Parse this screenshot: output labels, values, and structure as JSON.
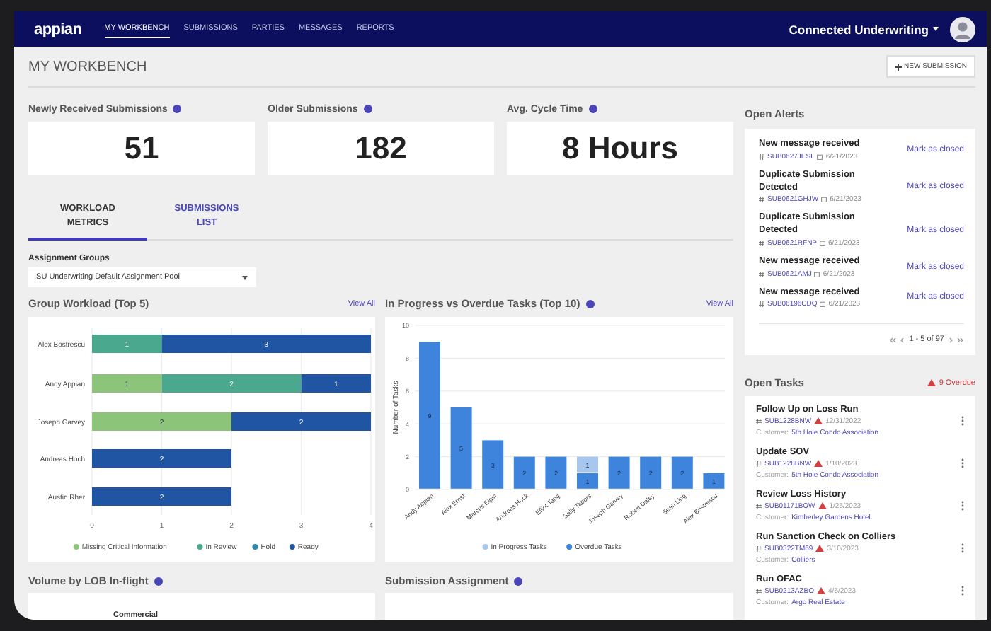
{
  "nav": {
    "logo": "appian",
    "items": [
      {
        "label": "MY WORKBENCH",
        "selected": true
      },
      {
        "label": "SUBMISSIONS",
        "selected": false
      },
      {
        "label": "PARTIES",
        "selected": false
      },
      {
        "label": "MESSAGES",
        "selected": false
      },
      {
        "label": "REPORTS",
        "selected": false
      }
    ],
    "app_menu": "Connected Underwriting"
  },
  "page": {
    "title": "MY WORKBENCH",
    "new_button": "NEW SUBMISSION"
  },
  "kpis": [
    {
      "label": "Newly Received Submissions",
      "value": "51"
    },
    {
      "label": "Older Submissions",
      "value": "182"
    },
    {
      "label": "Avg. Cycle Time",
      "value": "8 Hours"
    }
  ],
  "tabs": [
    {
      "label": "WORKLOAD METRICS",
      "selected": true
    },
    {
      "label": "SUBMISSIONS LIST",
      "selected": false
    }
  ],
  "assignment_groups": {
    "label": "Assignment Groups",
    "value": "ISU Underwriting Default Assignment Pool"
  },
  "group_workload": {
    "title": "Group Workload (Top 5)",
    "link": "View All",
    "chart_data": {
      "type": "bar",
      "orientation": "horizontal",
      "stacked": true,
      "categories": [
        "Alex Bostrescu",
        "Andy Appian",
        "Joseph Garvey",
        "Andreas Hoch",
        "Austin Rher"
      ],
      "series": [
        {
          "name": "Missing Critical Information",
          "color": "#8cc47a",
          "values": [
            0,
            1,
            2,
            0,
            0
          ],
          "value_labels": [
            null,
            "1",
            "2",
            null,
            null
          ]
        },
        {
          "name": "In Review",
          "color": "#4aa88f",
          "values": [
            1,
            2,
            0,
            0,
            0
          ],
          "value_labels": [
            "1",
            "2",
            null,
            null,
            null
          ]
        },
        {
          "name": "Hold",
          "color": "#2f86a6",
          "values": [
            0,
            0,
            0,
            0,
            0
          ],
          "value_labels": [
            null,
            null,
            null,
            null,
            null
          ]
        },
        {
          "name": "Ready",
          "color": "#1f55a2",
          "values": [
            3,
            1,
            2,
            2,
            2
          ],
          "value_labels": [
            "3",
            "1",
            "2",
            "2",
            "2"
          ]
        }
      ],
      "xlim": [
        0,
        4
      ],
      "xticks": [
        0,
        1,
        2,
        3,
        4
      ],
      "grid": true,
      "legend": "bottom"
    }
  },
  "tasks_chart": {
    "title": "In Progress vs Overdue Tasks (Top 10)",
    "link": "View All",
    "chart_data": {
      "type": "bar",
      "orientation": "vertical",
      "stacked": true,
      "categories": [
        "Andy Appian",
        "Alex Ernst",
        "Marcus Elgin",
        "Andreas Hock",
        "Elliot Tang",
        "Sally Tabors",
        "Joseph Garvey",
        "Robert Daley",
        "Sean Ling",
        "Alex Bostrescu"
      ],
      "series": [
        {
          "name": "In Progress Tasks",
          "color": "#a7c7ee",
          "values": [
            0,
            0,
            0,
            0,
            0,
            1,
            0,
            0,
            0,
            0
          ],
          "value_labels": [
            null,
            null,
            null,
            null,
            null,
            "1",
            null,
            null,
            null,
            null
          ]
        },
        {
          "name": "Overdue Tasks",
          "color": "#3f84dc",
          "values": [
            9,
            5,
            3,
            2,
            2,
            1,
            2,
            2,
            2,
            1
          ],
          "value_labels": [
            "9",
            "5",
            "3",
            "2",
            "2",
            "1",
            "2",
            "2",
            "2",
            "1"
          ]
        }
      ],
      "ylabel": "Number of Tasks",
      "ylim": [
        0,
        10
      ],
      "yticks": [
        0,
        2,
        4,
        6,
        8,
        10
      ],
      "grid": true,
      "legend": "bottom"
    }
  },
  "volume_by_lob": {
    "title": "Volume by LOB In-flight",
    "row_label": "Commercial"
  },
  "submission_assignment": {
    "title": "Submission Assignment"
  },
  "open_alerts": {
    "title": "Open Alerts",
    "alerts": [
      {
        "title": "New message received",
        "id": "SUB0627JESL",
        "date": "6/21/2023",
        "action": "Mark as closed"
      },
      {
        "title": "Duplicate Submission Detected",
        "id": "SUB0621GHJW",
        "date": "6/21/2023",
        "action": "Mark as closed"
      },
      {
        "title": "Duplicate Submission Detected",
        "id": "SUB0621RFNP",
        "date": "6/21/2023",
        "action": "Mark as closed"
      },
      {
        "title": "New message received",
        "id": "SUB0621AMJ",
        "date": "6/21/2023",
        "action": "Mark as closed"
      },
      {
        "title": "New message received",
        "id": "SUB06196CDQ",
        "date": "6/21/2023",
        "action": "Mark as closed"
      }
    ],
    "pagination": "1 - 5 of 97"
  },
  "open_tasks": {
    "title": "Open Tasks",
    "overdue": "9 Overdue",
    "tasks": [
      {
        "title": "Follow Up on Loss Run",
        "id": "SUB1228BNW",
        "date": "12/31/2022",
        "overdue": true,
        "customer_label": "Customer:",
        "customer": "5th Hole Condo Association"
      },
      {
        "title": "Update SOV",
        "id": "SUB1228BNW",
        "date": "1/10/2023",
        "overdue": true,
        "customer_label": "Customer:",
        "customer": "5th Hole Condo Association"
      },
      {
        "title": "Review Loss History",
        "id": "SUB01171BQW",
        "date": "1/25/2023",
        "overdue": true,
        "customer_label": "Customer:",
        "customer": "Kimberley Gardens Hotel"
      },
      {
        "title": "Run Sanction Check on Colliers",
        "id": "SUB0322TM69",
        "date": "3/10/2023",
        "overdue": true,
        "customer_label": "Customer:",
        "customer": "Colliers"
      },
      {
        "title": "Run OFAC",
        "id": "SUB0213AZBO",
        "date": "4/5/2023",
        "overdue": true,
        "customer_label": "Customer:",
        "customer": "Argo Real Estate"
      }
    ]
  }
}
